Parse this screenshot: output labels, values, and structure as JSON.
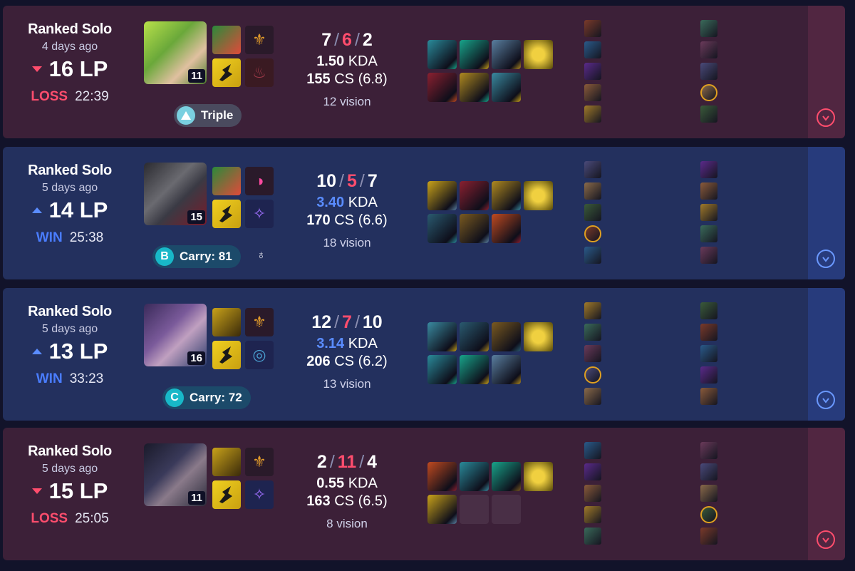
{
  "matches": [
    {
      "result_type": "loss",
      "queue": "Ranked Solo",
      "time_ago": "4 days ago",
      "lp": "16 LP",
      "lp_direction": "down",
      "result": "LOSS",
      "duration": "22:39",
      "champion_icon": "green-haired-champion",
      "champion_level": "11",
      "badge": {
        "icon": "triangle-icon",
        "label": "Triple",
        "style": "grey"
      },
      "kills": "7",
      "deaths": "6",
      "assists": "2",
      "kda_value": "1.50",
      "kda_label": "KDA",
      "kda_color": "white",
      "cs_value": "155",
      "cs_rest": "CS (6.8)",
      "vision": "12 vision",
      "items_filled": 7
    },
    {
      "result_type": "win",
      "queue": "Ranked Solo",
      "time_ago": "5 days ago",
      "lp": "14 LP",
      "lp_direction": "up",
      "result": "WIN",
      "duration": "25:38",
      "champion_icon": "masked-champion",
      "champion_level": "15",
      "badge": {
        "icon": "letter-b",
        "label": "Carry: 81",
        "letter": "B",
        "style": "teal"
      },
      "medal_icon": "medal-icon",
      "kills": "10",
      "deaths": "5",
      "assists": "7",
      "kda_value": "3.40",
      "kda_label": "KDA",
      "kda_color": "blue",
      "cs_value": "170",
      "cs_rest": "CS (6.6)",
      "vision": "18 vision",
      "items_filled": 7
    },
    {
      "result_type": "win",
      "queue": "Ranked Solo",
      "time_ago": "5 days ago",
      "lp": "13 LP",
      "lp_direction": "up",
      "result": "WIN",
      "duration": "33:23",
      "champion_icon": "hatted-champion",
      "champion_level": "16",
      "badge": {
        "icon": "letter-c",
        "label": "Carry: 72",
        "letter": "C",
        "style": "teal"
      },
      "kills": "12",
      "deaths": "7",
      "assists": "10",
      "kda_value": "3.14",
      "kda_label": "KDA",
      "kda_color": "blue",
      "cs_value": "206",
      "cs_rest": "CS (6.2)",
      "vision": "13 vision",
      "items_filled": 7
    },
    {
      "result_type": "loss",
      "queue": "Ranked Solo",
      "time_ago": "5 days ago",
      "lp": "15 LP",
      "lp_direction": "down",
      "result": "LOSS",
      "duration": "25:05",
      "champion_icon": "dark-haired-champion",
      "champion_level": "11",
      "kills": "2",
      "deaths": "11",
      "assists": "4",
      "kda_value": "0.55",
      "kda_label": "KDA",
      "kda_color": "white",
      "cs_value": "163",
      "cs_rest": "CS (6.5)",
      "vision": "8 vision",
      "items_filled": 5
    }
  ],
  "expand_icon": "chevron-down-icon",
  "colors": {
    "loss_bg": "#3c2038",
    "win_bg": "#23305e",
    "loss_accent": "#ff4d6d",
    "win_accent": "#4a7dff"
  }
}
